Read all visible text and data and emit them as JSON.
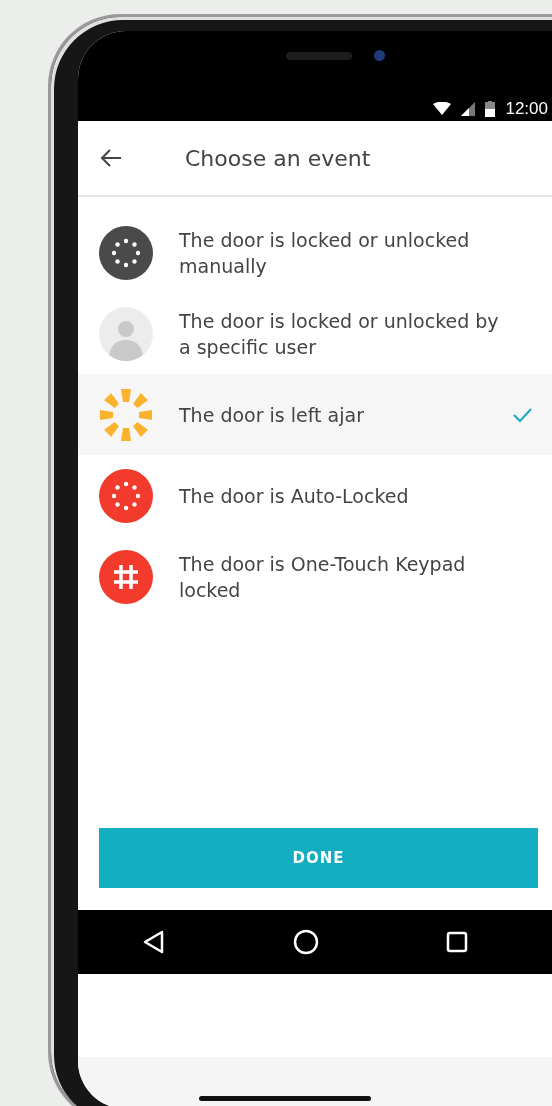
{
  "status_bar": {
    "time": "12:00"
  },
  "header": {
    "title": "Choose an event"
  },
  "events": [
    {
      "kind": "dots",
      "color": "#4a4a4a",
      "label": "The door is locked or unlocked manually",
      "selected": false
    },
    {
      "kind": "avatar",
      "label": "The door is locked or unlocked by a specific user",
      "selected": false
    },
    {
      "kind": "burst",
      "color": "#fbb22e",
      "label": "The door is left ajar",
      "selected": true
    },
    {
      "kind": "dots",
      "color": "#f23a2d",
      "label": "The door is Auto-Locked",
      "selected": false
    },
    {
      "kind": "hash",
      "color": "#f23a2d",
      "label": "The door is One-Touch Keypad locked",
      "selected": false
    }
  ],
  "done_button": {
    "label": "DONE"
  }
}
